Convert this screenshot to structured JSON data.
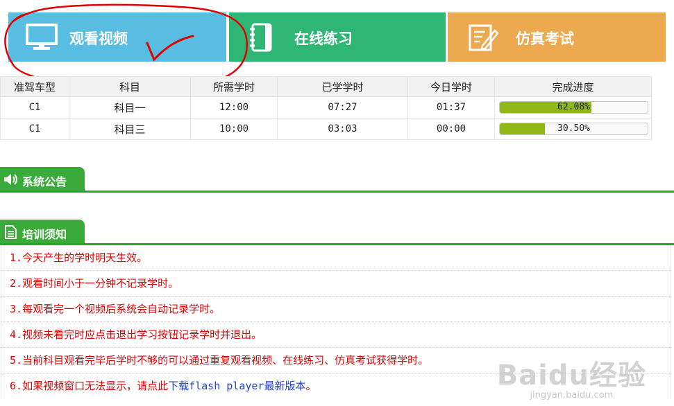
{
  "tiles": [
    {
      "label": "观看视频",
      "icon": "monitor-icon",
      "color": "#58bde0"
    },
    {
      "label": "在线练习",
      "icon": "notebook-icon",
      "color": "#2fb675"
    },
    {
      "label": "仿真考试",
      "icon": "edit-icon",
      "color": "#eda94f"
    }
  ],
  "annotation_color": "#e00000",
  "progress": {
    "headers": [
      "准驾车型",
      "科目",
      "所需学时",
      "已学学时",
      "今日学时",
      "完成进度"
    ],
    "rows": [
      {
        "vehicle": "C1",
        "subject": "科目一",
        "required": "12:00",
        "studied": "07:27",
        "today": "01:37",
        "progress_text": "62.08%",
        "progress_pct": 62.08
      },
      {
        "vehicle": "C1",
        "subject": "科目三",
        "required": "10:00",
        "studied": "03:03",
        "today": "00:00",
        "progress_text": "30.50%",
        "progress_pct": 30.5
      }
    ],
    "bar_color": "#8fb818"
  },
  "announcement": {
    "title": "系统公告",
    "icon": "speaker-icon"
  },
  "training": {
    "title": "培训须知",
    "icon": "document-icon",
    "items": [
      {
        "num": "1.",
        "text": "今天产生的学时明天生效。"
      },
      {
        "num": "2.",
        "text": "观看时间小于一分钟不记录学时。"
      },
      {
        "num": "3.",
        "text": "每观看完一个视频后系统会自动记录学时。"
      },
      {
        "num": "4.",
        "text": "视频未看完时应点击退出学习按钮记录学时并退出。"
      },
      {
        "num": "5.",
        "text": "当前科目观看完毕后学时不够的可以通过重复观看视频、在线练习、仿真考试获得学时。"
      }
    ],
    "last": {
      "num": "6.",
      "before": "如果视频窗口无法显示，请点此",
      "link": "下载flash player最新版本",
      "after": "。"
    }
  },
  "watermark": {
    "big": "Baidu经验",
    "small": "jingyan.baidu.com"
  },
  "accent_green": "#22aa22"
}
